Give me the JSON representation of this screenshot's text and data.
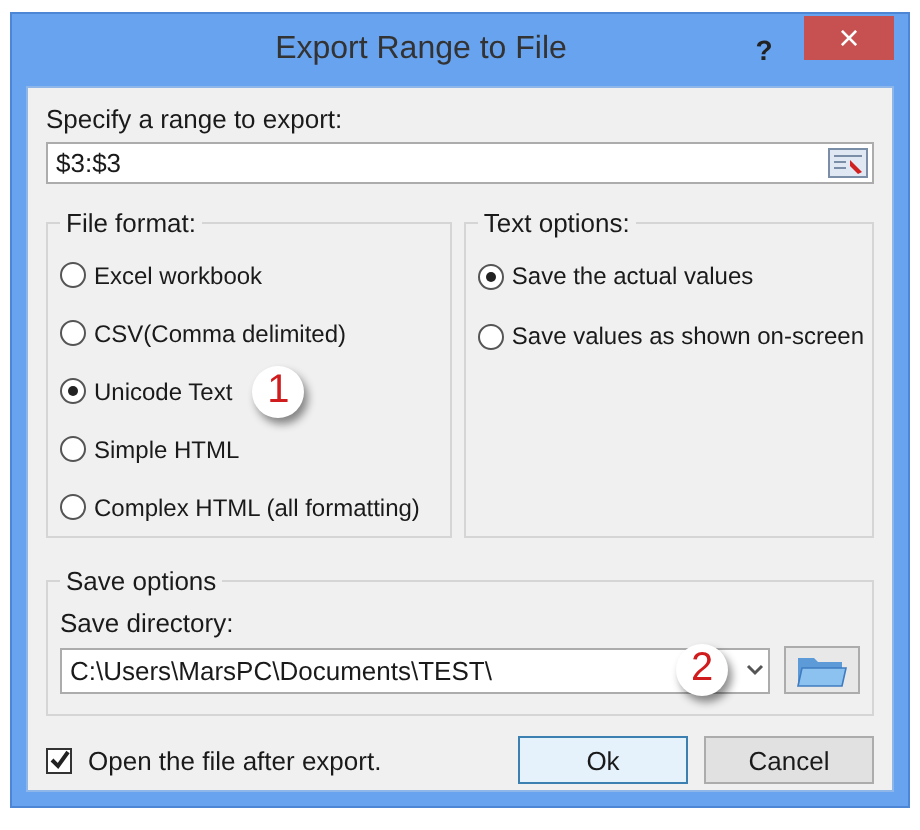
{
  "window": {
    "title": "Export Range to File",
    "help": "?",
    "close": "×"
  },
  "range": {
    "label": "Specify a range to export:",
    "value": "$3:$3"
  },
  "file_format": {
    "title": "File format:",
    "options": [
      {
        "label": "Excel workbook",
        "selected": false
      },
      {
        "label": "CSV(Comma delimited)",
        "selected": false
      },
      {
        "label": "Unicode Text",
        "selected": true,
        "callout": "1"
      },
      {
        "label": "Simple HTML",
        "selected": false
      },
      {
        "label": "Complex HTML (all formatting)",
        "selected": false
      }
    ]
  },
  "text_options": {
    "title": "Text options:",
    "options": [
      {
        "label": "Save the actual values",
        "selected": true
      },
      {
        "label": "Save values as shown on-screen",
        "selected": false
      }
    ]
  },
  "save_options": {
    "title": "Save options",
    "directory_label": "Save directory:",
    "directory": "C:\\Users\\MarsPC\\Documents\\TEST\\",
    "callout": "2"
  },
  "open_after": {
    "label": "Open the file after export.",
    "checked": true
  },
  "buttons": [
    {
      "label": "Ok",
      "default": true
    },
    {
      "label": "Cancel",
      "default": false
    }
  ]
}
